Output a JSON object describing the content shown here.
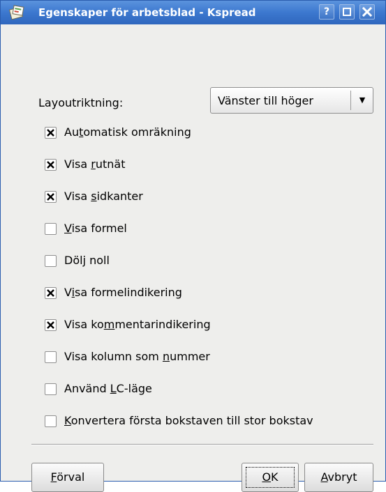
{
  "window": {
    "title": "Egenskaper för arbetsblad - Kspread",
    "buttons": {
      "help": "?",
      "maximize": "□",
      "close": "✕"
    }
  },
  "layout": {
    "label": "Layoutriktning:",
    "selected": "Vänster till höger"
  },
  "options": [
    {
      "pre": "Au",
      "mn": "t",
      "post": "omatisk omräkning",
      "checked": true
    },
    {
      "pre": "Visa ",
      "mn": "r",
      "post": "utnät",
      "checked": true
    },
    {
      "pre": "Visa ",
      "mn": "s",
      "post": "idkanter",
      "checked": true
    },
    {
      "pre": "",
      "mn": "V",
      "post": "isa formel",
      "checked": false
    },
    {
      "pre": "Döl",
      "mn": "j",
      "post": " noll",
      "checked": false
    },
    {
      "pre": "V",
      "mn": "i",
      "post": "sa formelindikering",
      "checked": true
    },
    {
      "pre": "Visa ko",
      "mn": "m",
      "post": "mentarindikering",
      "checked": true
    },
    {
      "pre": "Visa kolumn som ",
      "mn": "n",
      "post": "ummer",
      "checked": false
    },
    {
      "pre": "Använd ",
      "mn": "L",
      "post": "C-läge",
      "checked": false
    },
    {
      "pre": "",
      "mn": "K",
      "post": "onvertera första bokstaven till stor bokstav",
      "checked": false
    }
  ],
  "buttons": {
    "defaults": {
      "mn": "F",
      "post": "örval"
    },
    "ok": {
      "mn": "O",
      "post": "K"
    },
    "cancel": {
      "mn": "A",
      "post": "vbryt"
    }
  },
  "colors": {
    "titlebar": "#3c78cf",
    "face": "#eeeeec"
  }
}
